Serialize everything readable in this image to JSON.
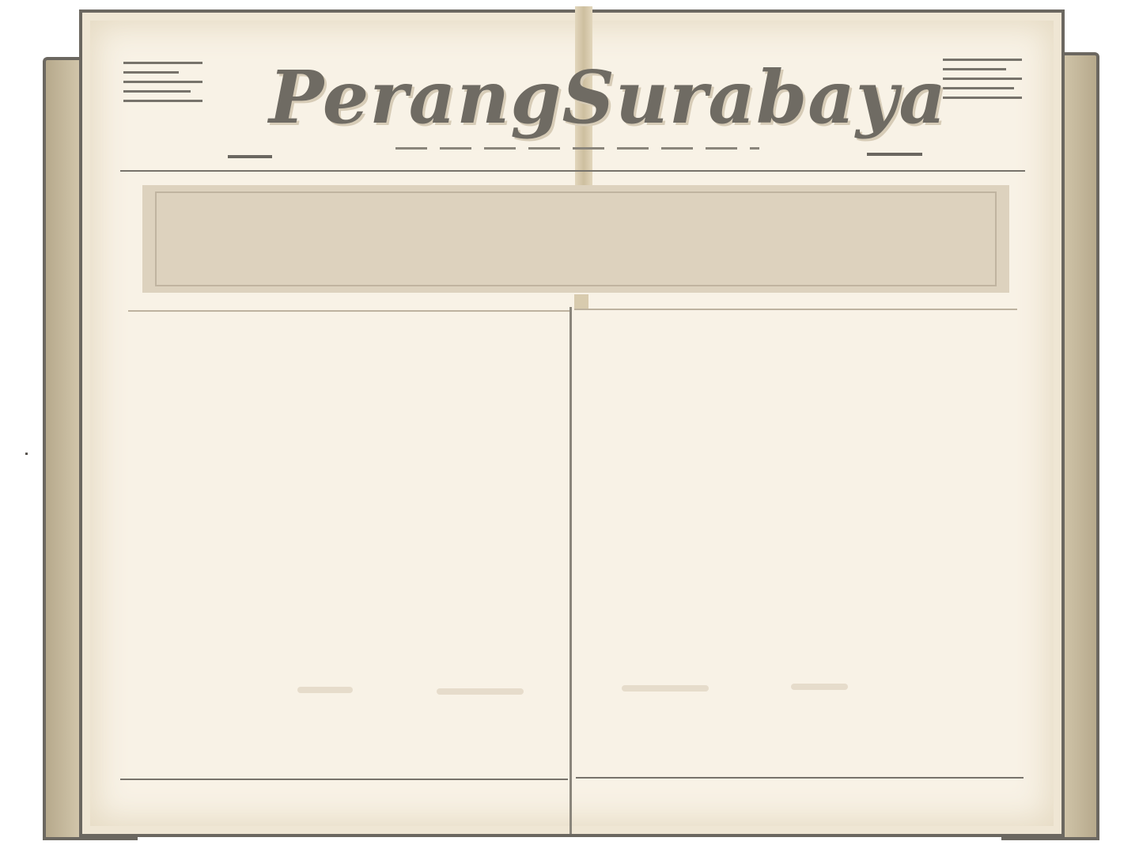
{
  "newspaper": {
    "masthead_title": "PerangSurabaya",
    "headline": "",
    "left_column_text": "",
    "right_column_text": ""
  },
  "colors": {
    "paper": "#f8f2e6",
    "ink": "#6f6b63",
    "border": "#6b6760",
    "headline_box": "#ddd2be"
  }
}
